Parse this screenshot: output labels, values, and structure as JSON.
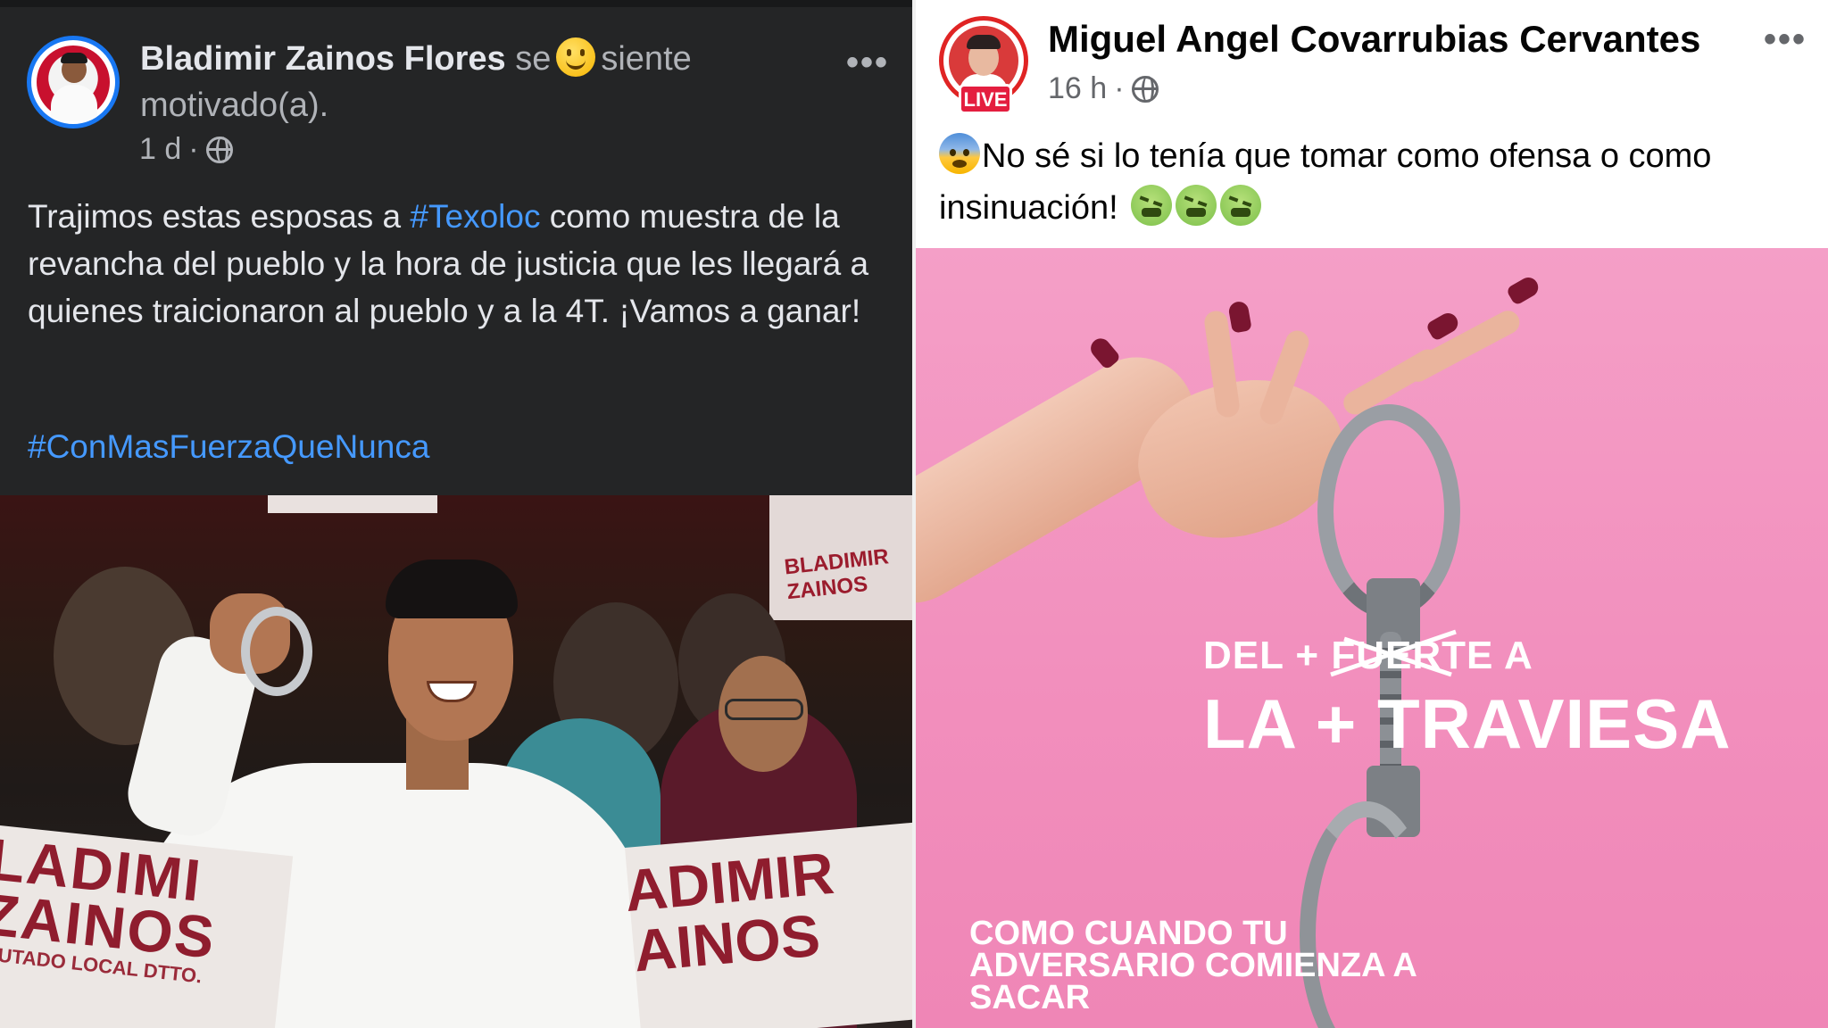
{
  "left_post": {
    "author": "Bladimir Zainos Flores",
    "feeling_prefix": "se",
    "feeling_emoji": "slightly-smiling-face-emoji",
    "feeling_suffix": "siente motivado(a).",
    "time": "1 d",
    "separator": "·",
    "privacy_icon": "globe-icon",
    "more": "•••",
    "text_part1": "Trajimos estas esposas a ",
    "hashtag1": "#Texoloc",
    "text_part2": " como muestra de la revancha del pueblo y la hora de justicia que les llegará a quienes traicionaron al pueblo y a la 4T. ¡Vamos a ganar!",
    "hashtag2": "#ConMasFuerzaQueNunca",
    "photo": {
      "sign_top_right": "BLADIMIR ZAINOS",
      "sign_left_line1": "LADIMI",
      "sign_left_line2": "ZAINOS",
      "sign_left_line3": "IPUTADO LOCAL DTTO.",
      "sign_right_line1": "ADIMIR",
      "sign_right_line2": "AINOS"
    }
  },
  "right_post": {
    "author": "Miguel Angel Covarrubias Cervantes",
    "live_badge": "LIVE",
    "time": "16 h",
    "separator": "·",
    "privacy_icon": "globe-icon",
    "more": "•••",
    "text": "No sé si lo tenía que tomar como ofensa o como insinuación!",
    "emojis": [
      "fearful-face-emoji",
      "nauseated-face-emoji",
      "nauseated-face-emoji",
      "nauseated-face-emoji"
    ],
    "ad": {
      "line1_a": "DEL + ",
      "line1_struck": "FUERTE",
      "line1_b": " A",
      "line2": "LA + TRAVIESA",
      "line3": "COMO CUANDO TU ADVERSARIO COMIENZA A SACAR"
    }
  },
  "colors": {
    "dark_bg": "#242526",
    "hashtag": "#4599ff",
    "ad_pink": "#f28fbd",
    "live_red": "#e41e3f"
  }
}
